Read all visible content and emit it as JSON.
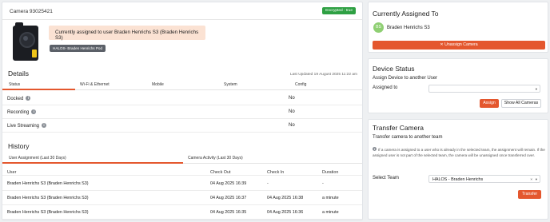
{
  "left": {
    "camera_title": "Camera 93025421",
    "encrypted_badge": "Encrypted : true",
    "assigned_banner": "Currently assigned to user Braden Henrichs S3 (Braden Henrichs S3)",
    "pod_badge": "HALOS- Braden Henrichs Pod",
    "details": {
      "title": "Details",
      "last_updated": "Last Updated 19 August 2025 11:22 am",
      "tabs": [
        "Status",
        "Wi-Fi & Ethernet",
        "Mobile",
        "System",
        "Config"
      ],
      "rows": [
        {
          "label": "Docked",
          "value": "No"
        },
        {
          "label": "Recording",
          "value": "No"
        },
        {
          "label": "Live Streaming",
          "value": "No"
        }
      ]
    },
    "history": {
      "title": "History",
      "tabs": [
        "User Assignment (Last 30 Days)",
        "Camera Activity (Last 30 Days)"
      ],
      "columns": [
        "User",
        "Check Out",
        "Check In",
        "Duration"
      ],
      "rows": [
        {
          "user": "Braden Henrichs S3 (Braden Henrichs S3)",
          "check_out": "04 Aug 2025 16:39",
          "check_in": "-",
          "duration": "-"
        },
        {
          "user": "Braden Henrichs S3 (Braden Henrichs S3)",
          "check_out": "04 Aug 2025 16:37",
          "check_in": "04 Aug 2025 16:38",
          "duration": "a minute"
        },
        {
          "user": "Braden Henrichs S3 (Braden Henrichs S3)",
          "check_out": "04 Aug 2025 16:35",
          "check_in": "04 Aug 2025 16:36",
          "duration": "a minute"
        }
      ]
    }
  },
  "current": {
    "title": "Currently Assigned To",
    "avatar_initials": "BS",
    "name": "Braden Henrichs S3",
    "unassign_label": "Unassign Camera",
    "unassign_icon": "close-icon"
  },
  "status": {
    "title": "Device Status",
    "subtitle": "Assign Device to another User",
    "assigned_to_label": "Assigned to",
    "assigned_to_value": "",
    "assign_label": "Assign",
    "show_all_label": "Show All Cameras"
  },
  "transfer": {
    "title": "Transfer Camera",
    "subtitle": "Transfer camera to another team",
    "note": "If a camera is assigned to a user who is already in the selected team, the assignment will remain. If the assigned user is not part of the selected team, the camera will be unassigned once transferred over.",
    "select_team_label": "Select Team",
    "select_team_value": "HALOS - Braden Henrichs",
    "transfer_label": "Transfer"
  },
  "colors": {
    "accent": "#e4572e",
    "success": "#2ea043",
    "banner": "#fbe2d3"
  }
}
